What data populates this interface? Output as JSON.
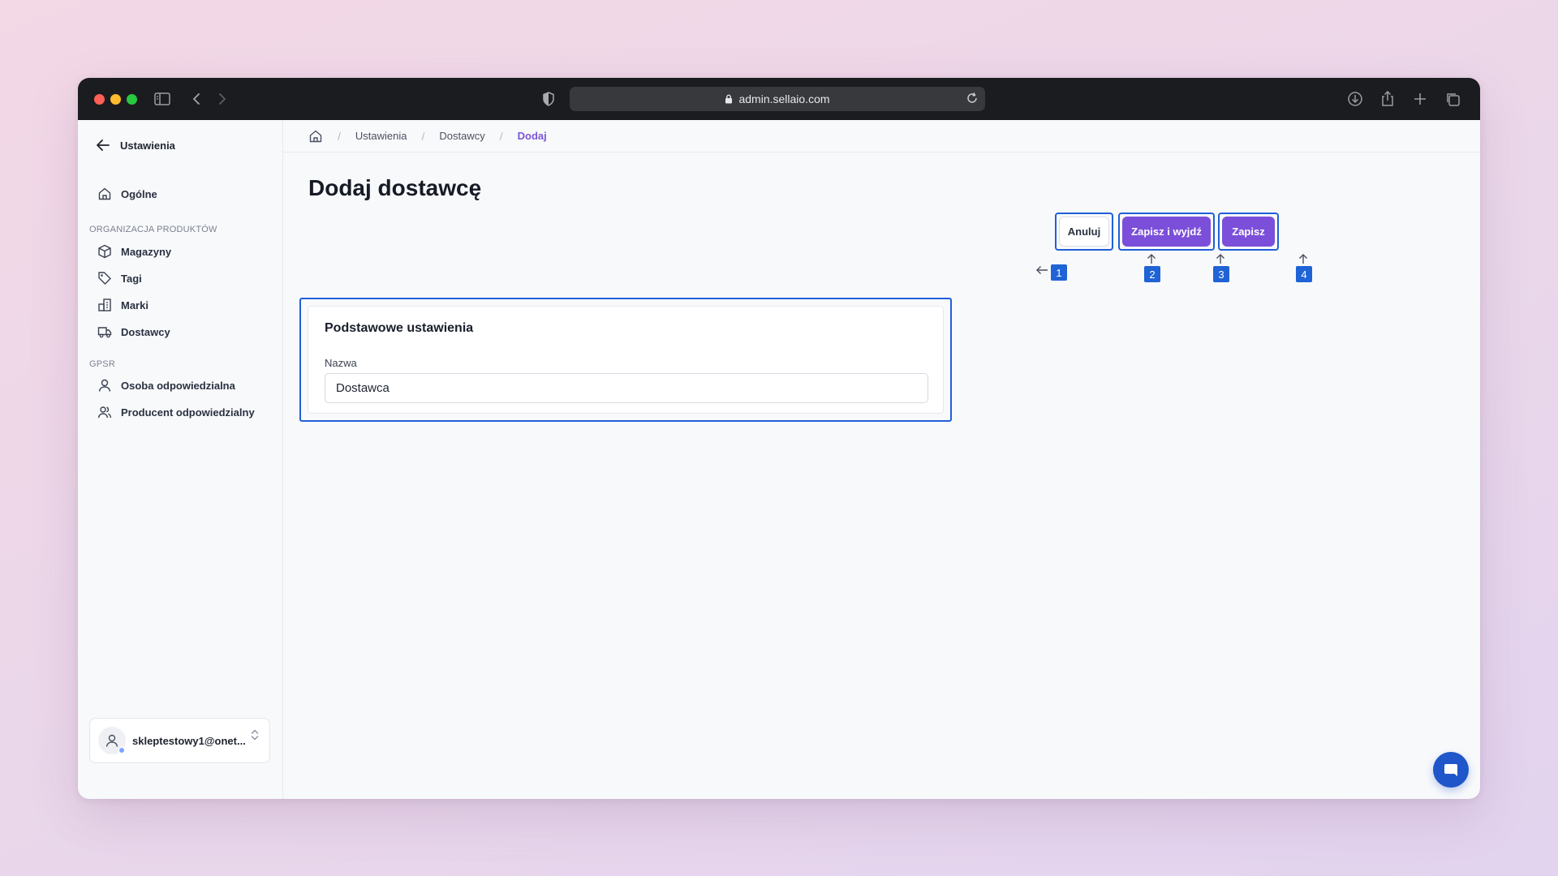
{
  "browser": {
    "url": "admin.sellaio.com"
  },
  "sidebar": {
    "back_label": "Ustawienia",
    "general_label": "Ogólne",
    "section_products": "ORGANIZACJA PRODUKTÓW",
    "products_items": [
      {
        "label": "Magazyny",
        "icon": "box-icon"
      },
      {
        "label": "Tagi",
        "icon": "tag-icon"
      },
      {
        "label": "Marki",
        "icon": "brand-icon"
      },
      {
        "label": "Dostawcy",
        "icon": "truck-icon"
      }
    ],
    "section_gpsr": "GPSR",
    "gpsr_items": [
      {
        "label": "Osoba odpowiedzialna",
        "icon": "user-icon"
      },
      {
        "label": "Producent odpowiedzialny",
        "icon": "users-icon"
      }
    ],
    "user_email": "skleptestowy1@onet..."
  },
  "breadcrumb": {
    "items": [
      "Ustawienia",
      "Dostawcy"
    ],
    "current": "Dodaj"
  },
  "page": {
    "title": "Dodaj dostawcę"
  },
  "actions": {
    "cancel": "Anuluj",
    "save_exit": "Zapisz i wyjdź",
    "save": "Zapisz"
  },
  "annotations": {
    "tag1": "1",
    "tag2": "2",
    "tag3": "3",
    "tag4": "4"
  },
  "form": {
    "section_title": "Podstawowe ustawienia",
    "name_label": "Nazwa",
    "name_value": "Dostawca"
  },
  "colors": {
    "accent": "#7b4fd9",
    "annotation": "#1f63d6"
  }
}
